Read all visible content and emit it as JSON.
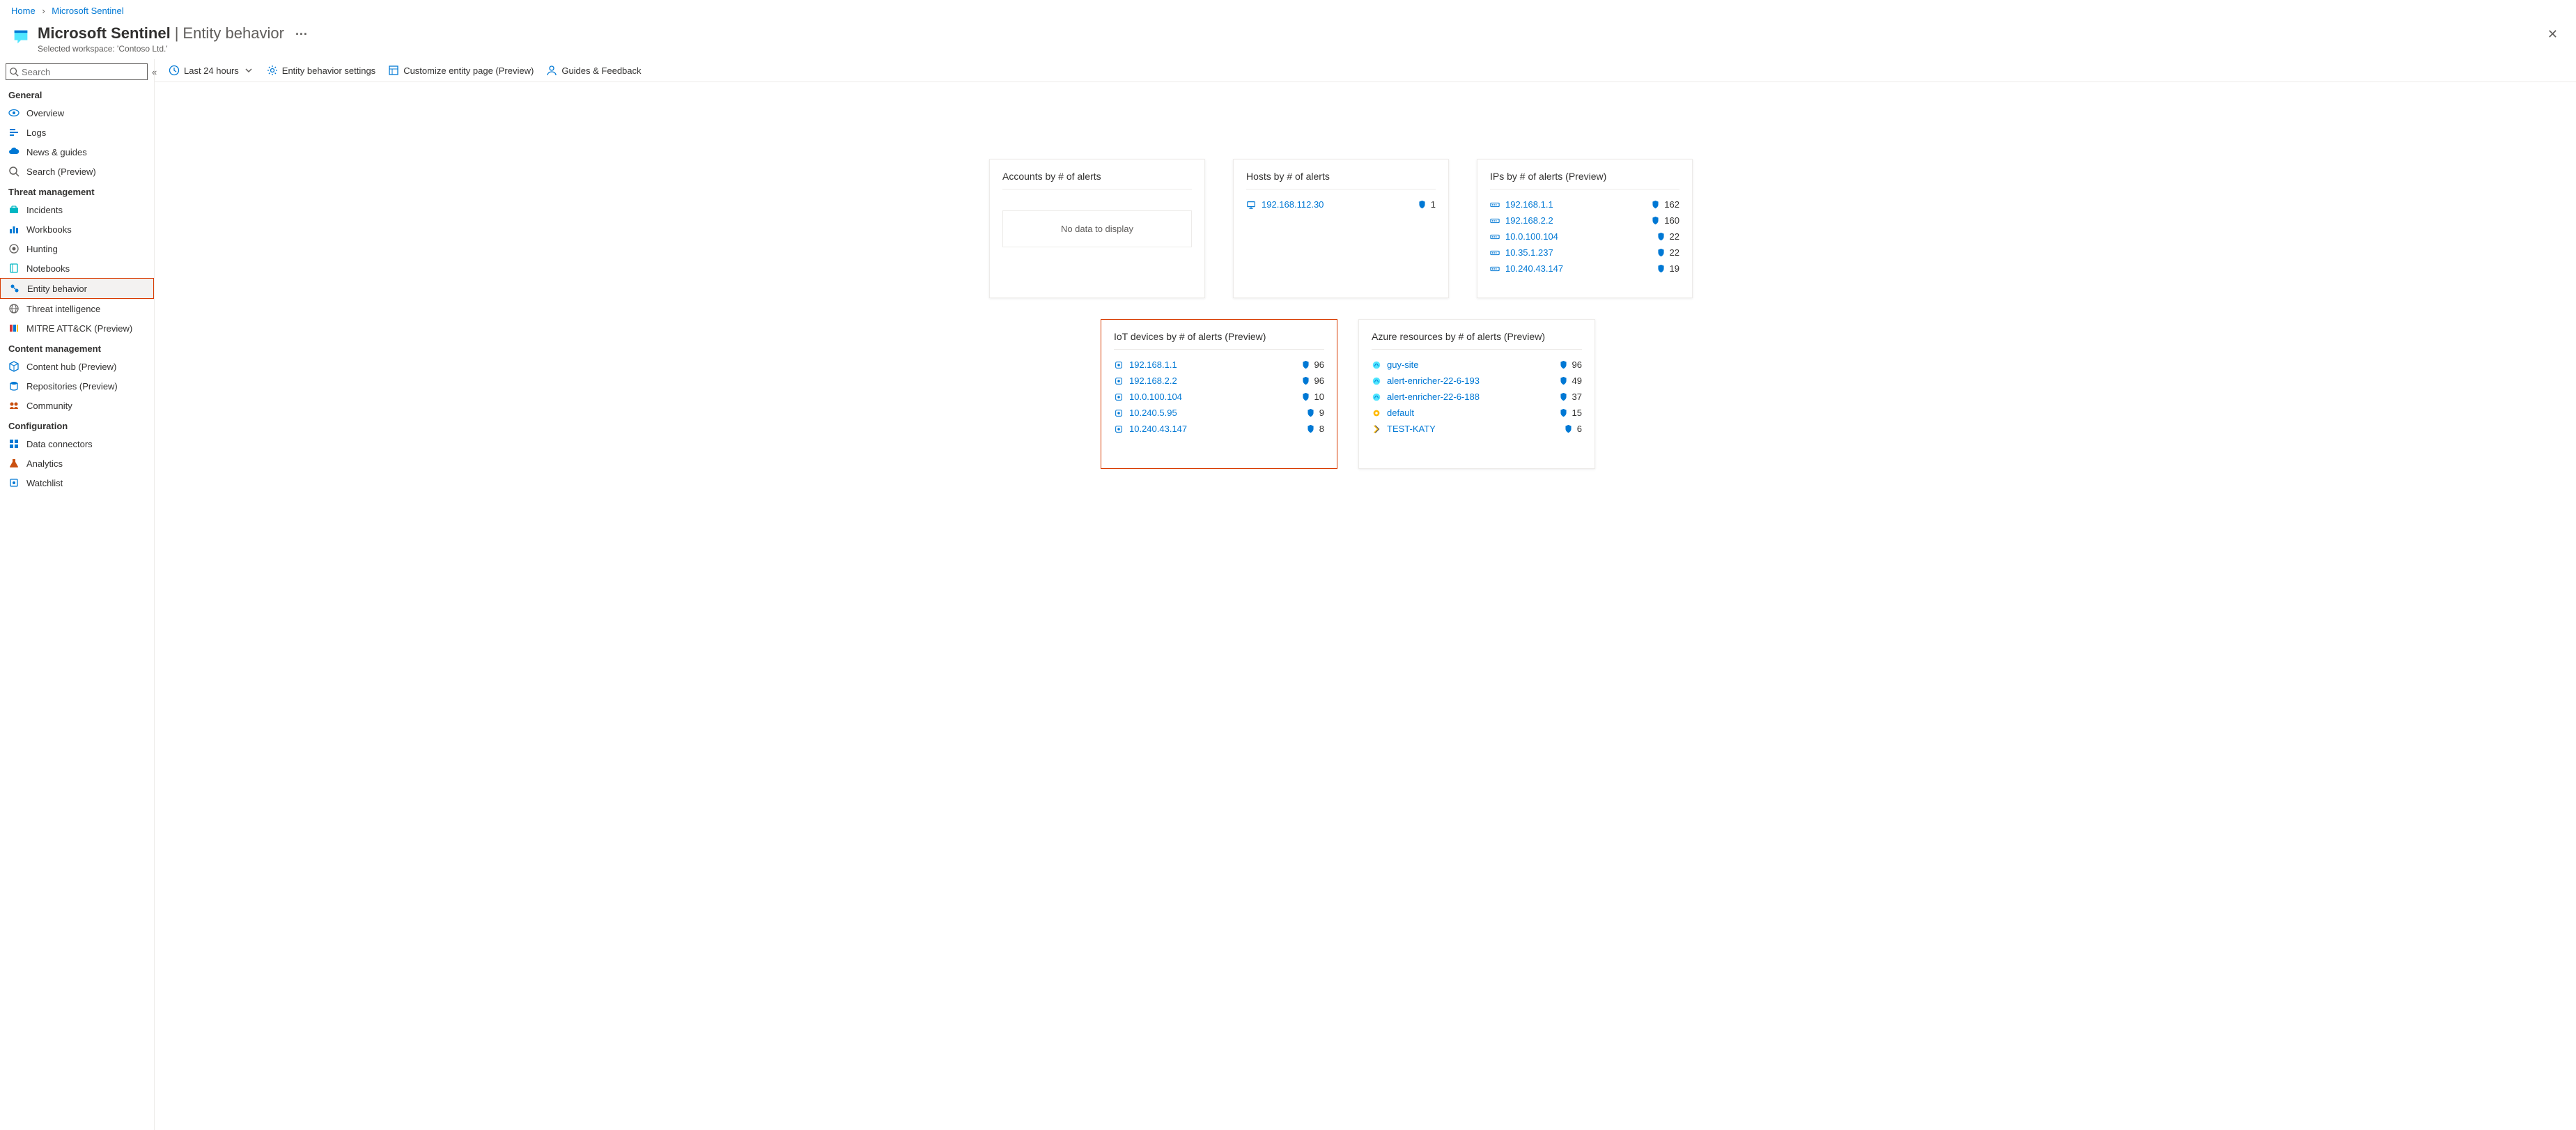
{
  "breadcrumb": {
    "home": "Home",
    "product": "Microsoft Sentinel"
  },
  "header": {
    "title_main": "Microsoft Sentinel",
    "title_sep": "|",
    "title_sub": "Entity behavior",
    "workspace": "Selected workspace: 'Contoso Ltd.'",
    "more": "···",
    "close": "✕"
  },
  "sidebar": {
    "search_placeholder": "Search",
    "collapse": "«",
    "groups": [
      {
        "label": "General",
        "items": [
          {
            "label": "Overview",
            "icon": "eye",
            "color": "ic-blue"
          },
          {
            "label": "Logs",
            "icon": "logs",
            "color": "ic-blue"
          },
          {
            "label": "News & guides",
            "icon": "cloud",
            "color": "ic-blue"
          },
          {
            "label": "Search (Preview)",
            "icon": "search",
            "color": "ic-gray"
          }
        ]
      },
      {
        "label": "Threat management",
        "items": [
          {
            "label": "Incidents",
            "icon": "briefcase",
            "color": "ic-teal"
          },
          {
            "label": "Workbooks",
            "icon": "chart",
            "color": "ic-blue"
          },
          {
            "label": "Hunting",
            "icon": "target",
            "color": "ic-gray"
          },
          {
            "label": "Notebooks",
            "icon": "notebook",
            "color": "ic-teal"
          },
          {
            "label": "Entity behavior",
            "icon": "entity",
            "color": "ic-blue",
            "selected": true,
            "boxed": true
          },
          {
            "label": "Threat intelligence",
            "icon": "globe",
            "color": "ic-gray"
          },
          {
            "label": "MITRE ATT&CK (Preview)",
            "icon": "mitre",
            "color": "ic-red"
          }
        ]
      },
      {
        "label": "Content management",
        "items": [
          {
            "label": "Content hub (Preview)",
            "icon": "cube",
            "color": "ic-blue"
          },
          {
            "label": "Repositories (Preview)",
            "icon": "repo",
            "color": "ic-blue"
          },
          {
            "label": "Community",
            "icon": "community",
            "color": "ic-orange"
          }
        ]
      },
      {
        "label": "Configuration",
        "items": [
          {
            "label": "Data connectors",
            "icon": "grid",
            "color": "ic-blue"
          },
          {
            "label": "Analytics",
            "icon": "flask",
            "color": "ic-orange"
          },
          {
            "label": "Watchlist",
            "icon": "watch",
            "color": "ic-blue"
          }
        ]
      }
    ]
  },
  "toolbar": {
    "timerange": "Last 24 hours",
    "settings": "Entity behavior settings",
    "customize": "Customize entity page (Preview)",
    "guides": "Guides & Feedback"
  },
  "cards": {
    "accounts": {
      "title": "Accounts by # of alerts",
      "empty": "No data to display"
    },
    "hosts": {
      "title": "Hosts by # of alerts",
      "rows": [
        {
          "name": "192.168.112.30",
          "count": "1"
        }
      ]
    },
    "ips": {
      "title": "IPs by # of alerts (Preview)",
      "rows": [
        {
          "name": "192.168.1.1",
          "count": "162"
        },
        {
          "name": "192.168.2.2",
          "count": "160"
        },
        {
          "name": "10.0.100.104",
          "count": "22"
        },
        {
          "name": "10.35.1.237",
          "count": "22"
        },
        {
          "name": "10.240.43.147",
          "count": "19"
        }
      ]
    },
    "iot": {
      "title": "IoT devices by # of alerts (Preview)",
      "rows": [
        {
          "name": "192.168.1.1",
          "count": "96"
        },
        {
          "name": "192.168.2.2",
          "count": "96"
        },
        {
          "name": "10.0.100.104",
          "count": "10"
        },
        {
          "name": "10.240.5.95",
          "count": "9"
        },
        {
          "name": "10.240.43.147",
          "count": "8"
        }
      ]
    },
    "azres": {
      "title": "Azure resources by # of alerts (Preview)",
      "rows": [
        {
          "name": "guy-site",
          "count": "96",
          "icon": "app"
        },
        {
          "name": "alert-enricher-22-6-193",
          "count": "49",
          "icon": "app"
        },
        {
          "name": "alert-enricher-22-6-188",
          "count": "37",
          "icon": "app"
        },
        {
          "name": "default",
          "count": "15",
          "icon": "gear"
        },
        {
          "name": "TEST-KATY",
          "count": "6",
          "icon": "func"
        }
      ]
    }
  }
}
